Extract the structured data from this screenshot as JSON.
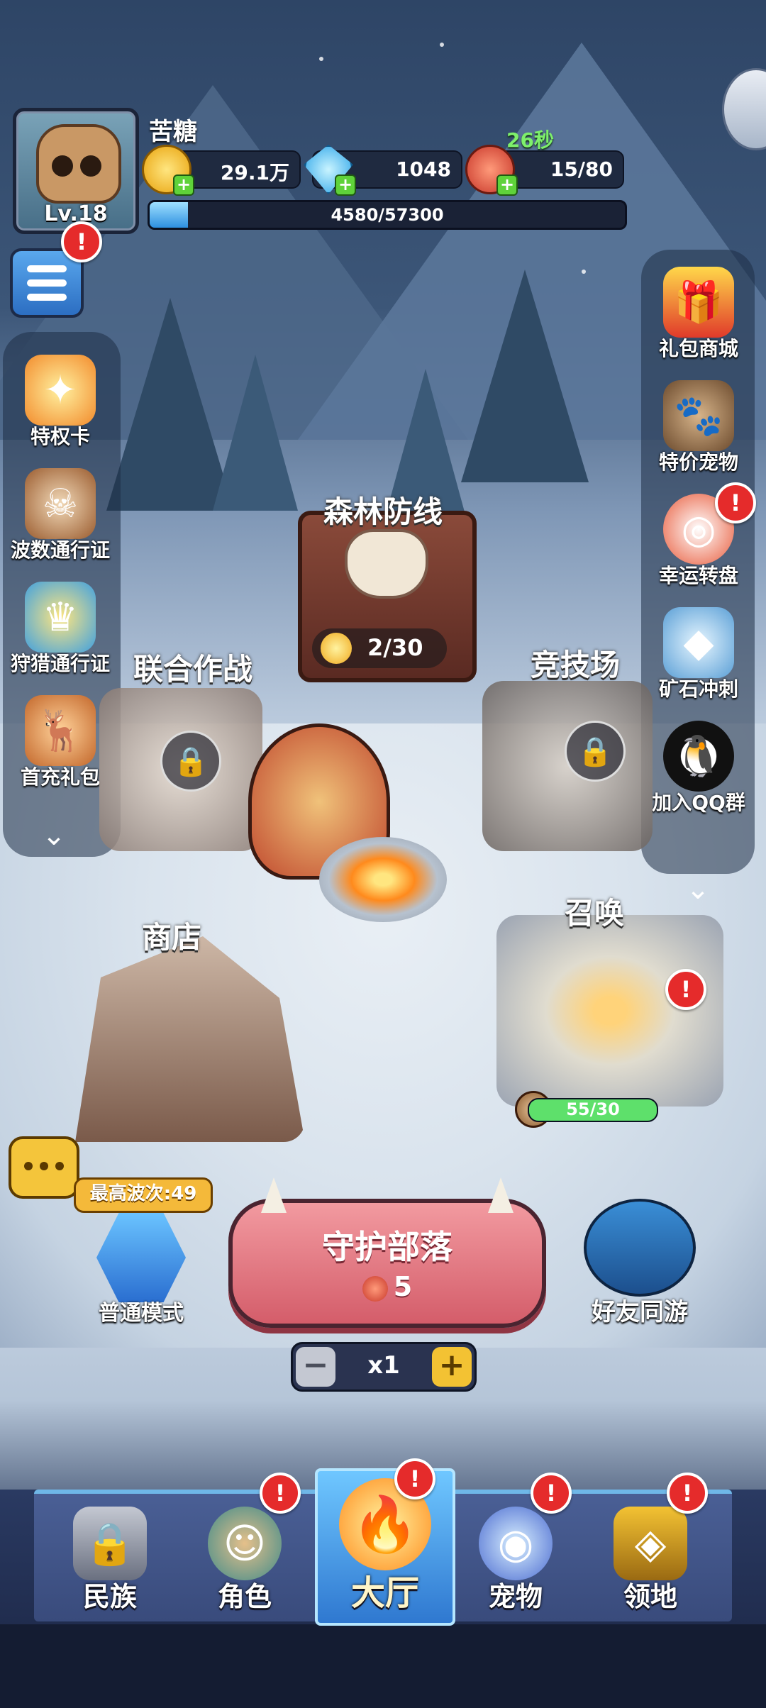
{
  "player": {
    "name": "苦糖",
    "level": "Lv.18"
  },
  "resources": {
    "gold": "29.1万",
    "diamond": "1048",
    "stamina": "15/80",
    "stamina_timer": "26秒"
  },
  "xp": {
    "text": "4580/57300",
    "fraction": 0.08
  },
  "left_menu": [
    {
      "label": "特权卡",
      "icon": "privilege-card-icon"
    },
    {
      "label": "波数通行证",
      "icon": "wave-pass-icon"
    },
    {
      "label": "狩猎通行证",
      "icon": "hunt-pass-icon"
    },
    {
      "label": "首充礼包",
      "icon": "first-recharge-icon"
    }
  ],
  "right_menu": [
    {
      "label": "礼包商城",
      "icon": "gift-shop-icon"
    },
    {
      "label": "特价宠物",
      "icon": "discount-pet-icon"
    },
    {
      "label": "幸运转盘",
      "icon": "lucky-wheel-icon"
    },
    {
      "label": "矿石冲刺",
      "icon": "ore-sprint-icon"
    },
    {
      "label": "加入QQ群",
      "icon": "qq-group-icon"
    }
  ],
  "map": {
    "forest_defense": {
      "label": "森林防线",
      "progress": "2/30"
    },
    "co_op": {
      "label": "联合作战"
    },
    "arena": {
      "label": "竞技场"
    },
    "shop": {
      "label": "商店"
    },
    "summon": {
      "label": "召唤",
      "progress": "55/30"
    }
  },
  "battle": {
    "title": "守护部落",
    "cost": "5",
    "multiplier": "x1",
    "best_wave": "最高波次:49",
    "mode": "普通模式",
    "friends": "好友同游"
  },
  "badge_mark": "!",
  "nav": [
    {
      "label": "民族",
      "icon": "tribe-icon",
      "active": false
    },
    {
      "label": "角色",
      "icon": "character-icon",
      "active": false
    },
    {
      "label": "大厅",
      "icon": "campfire-icon",
      "active": true
    },
    {
      "label": "宠物",
      "icon": "pet-egg-icon",
      "active": false
    },
    {
      "label": "领地",
      "icon": "territory-icon",
      "active": false
    }
  ],
  "colors": {
    "play_button": "#d45d6a",
    "accent_blue": "#2f78d0",
    "badge_red": "#e52b2b",
    "stamina_green": "#7ef06b"
  }
}
